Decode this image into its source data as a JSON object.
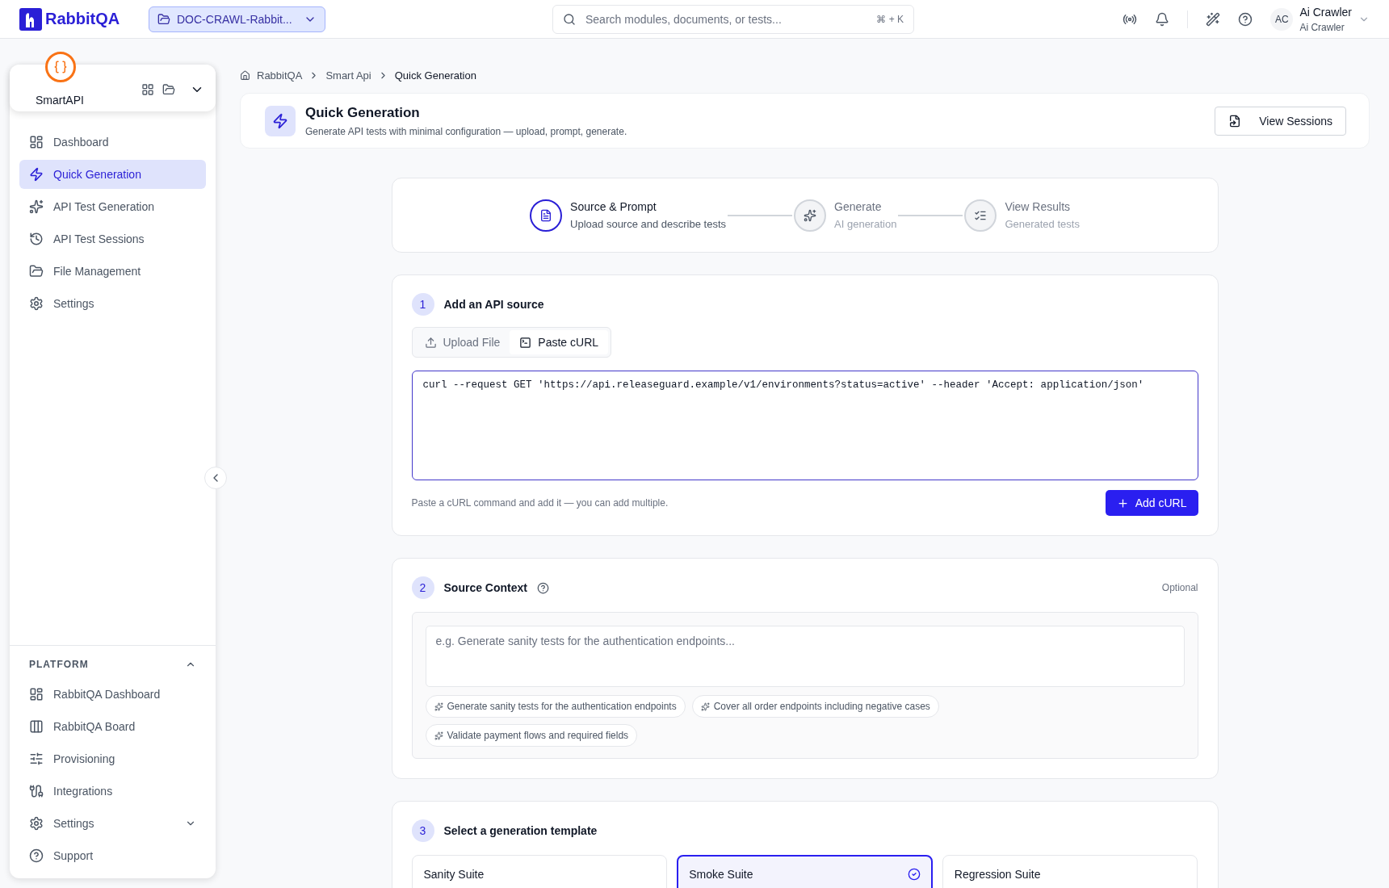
{
  "topbar": {
    "logo": "RabbitQA",
    "project": "DOC-CRAWL-Rabbit...",
    "search": {
      "placeholder": "Search modules, documents, or tests..."
    },
    "shortcut": "⌘ + K",
    "user": {
      "initials": "AC",
      "name": "Ai Crawler",
      "role": "Ai Crawler"
    }
  },
  "sidebar": {
    "module": "SmartAPI",
    "items": [
      {
        "label": "Dashboard",
        "selected": false
      },
      {
        "label": "Quick Generation",
        "selected": true
      },
      {
        "label": "API Test Generation",
        "selected": false
      },
      {
        "label": "API Test Sessions",
        "selected": false
      },
      {
        "label": "File Management",
        "selected": false
      },
      {
        "label": "Settings",
        "selected": false
      }
    ],
    "platform": {
      "title": "PLATFORM",
      "expanded": true,
      "items": [
        {
          "label": "RabbitQA Dashboard",
          "kind": "link"
        },
        {
          "label": "RabbitQA Board",
          "kind": "link"
        },
        {
          "label": "Provisioning",
          "kind": "link"
        },
        {
          "label": "Integrations",
          "kind": "link"
        },
        {
          "label": "Settings",
          "kind": "group"
        },
        {
          "label": "Support",
          "kind": "link"
        }
      ]
    }
  },
  "breadcrumb": [
    "RabbitQA",
    "Smart Api",
    "Quick Generation"
  ],
  "header": {
    "title": "Quick Generation",
    "subtitle": "Generate API tests with minimal configuration — upload, prompt, generate.",
    "button": "View Sessions"
  },
  "stepper": [
    {
      "title": "Source & Prompt",
      "subtitle": "Upload source and describe tests",
      "selected": true
    },
    {
      "title": "Generate",
      "subtitle": "AI generation",
      "selected": false
    },
    {
      "title": "View Results",
      "subtitle": "Generated tests",
      "selected": false
    }
  ],
  "source": {
    "number": "1",
    "title": "Add an API source",
    "tabs": [
      {
        "label": "Upload File",
        "selected": false
      },
      {
        "label": "Paste cURL",
        "selected": true
      }
    ],
    "value": "curl --request GET 'https://api.releaseguard.example/v1/environments?status=active' --header 'Accept: application/json'",
    "hint": "Paste a cURL command and add it — you can add multiple.",
    "button": "Add cURL"
  },
  "context": {
    "number": "2",
    "title": "Source Context",
    "optional": "Optional",
    "placeholder": "e.g. Generate sanity tests for the authentication endpoints...",
    "suggestions": [
      "Generate sanity tests for the authentication endpoints",
      "Cover all order endpoints including negative cases",
      "Validate payment flows and required fields"
    ]
  },
  "templates": {
    "number": "3",
    "title": "Select a generation template",
    "options": [
      {
        "label": "Sanity Suite",
        "selected": false
      },
      {
        "label": "Smoke Suite",
        "selected": true
      },
      {
        "label": "Regression Suite",
        "selected": false
      }
    ]
  }
}
